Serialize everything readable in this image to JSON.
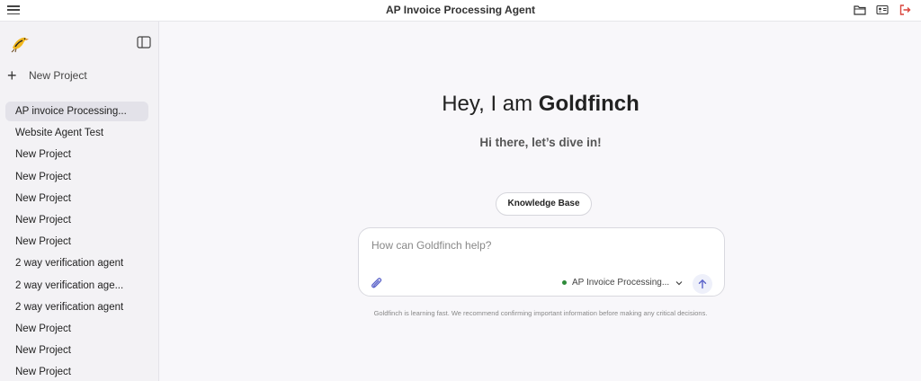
{
  "header": {
    "title": "AP Invoice Processing Agent",
    "icons": [
      "menu-icon",
      "folder-icon",
      "id-card-icon",
      "logout-icon"
    ]
  },
  "sidebar": {
    "new_project_label": "New Project",
    "items": [
      {
        "label": "AP invoice Processing...",
        "active": true
      },
      {
        "label": "Website Agent Test"
      },
      {
        "label": "New Project"
      },
      {
        "label": "New Project"
      },
      {
        "label": "New Project"
      },
      {
        "label": "New Project"
      },
      {
        "label": "New Project"
      },
      {
        "label": "2 way verification agent"
      },
      {
        "label": "2 way verification age..."
      },
      {
        "label": "2 way verification agent"
      },
      {
        "label": "New Project"
      },
      {
        "label": "New Project"
      },
      {
        "label": "New Project"
      }
    ]
  },
  "main": {
    "greeting_prefix": "Hey, I am ",
    "greeting_name": "Goldfinch",
    "subtitle": "Hi there, let’s dive in!",
    "knowledge_base_label": "Knowledge Base",
    "chat": {
      "placeholder": "How can Goldfinch help?",
      "value": "",
      "agent_selected": "AP Invoice Processing..."
    },
    "disclaimer": "Goldfinch is learning fast. We recommend confirming important information before making any critical decisions."
  },
  "colors": {
    "accent": "#5b63c9",
    "status_dot": "#2e8b3a",
    "logout": "#d9443b",
    "active_item_bg": "#e3e2e9"
  }
}
